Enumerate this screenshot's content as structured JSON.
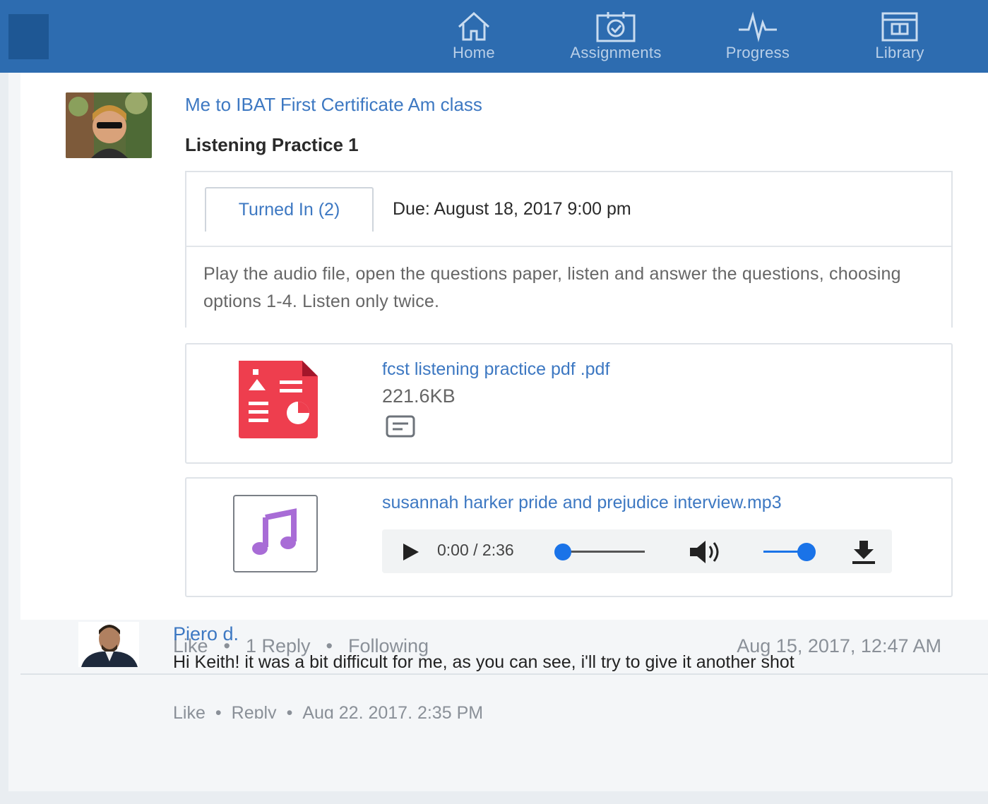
{
  "nav": {
    "items": [
      {
        "label": "Home",
        "icon": "home-icon"
      },
      {
        "label": "Assignments",
        "icon": "assignments-icon"
      },
      {
        "label": "Progress",
        "icon": "progress-icon"
      },
      {
        "label": "Library",
        "icon": "library-icon"
      }
    ]
  },
  "post": {
    "from": "Me to IBAT First Certificate Am class",
    "title": "Listening Practice 1",
    "turned_in_label": "Turned In (2)",
    "due": "Due: August 18, 2017 9:00 pm",
    "instructions": "Play the audio file, open the questions paper, listen and answer the questions, choosing options 1-4. Listen only twice.",
    "attachments": {
      "pdf": {
        "name": "fcst listening practice pdf .pdf",
        "size": "221.6KB",
        "icon": "pdf-file-icon"
      },
      "mp3": {
        "name": "susannah harker pride and prejudice interview.mp3",
        "icon": "music-icon"
      }
    },
    "player": {
      "time": "0:00 / 2:36",
      "volume": 1.0,
      "progress": 0.0
    },
    "actions": {
      "like": "Like",
      "reply": "1 Reply",
      "follow": "Following",
      "separator": "•"
    },
    "timestamp": "Aug 15, 2017, 12:47 AM"
  },
  "reply": {
    "author": "Piero d.",
    "body": "Hi Keith! it was a bit difficult for me, as you can see, i'll try to give it another shot",
    "like": "Like",
    "reply": "Reply",
    "separator": "•",
    "timestamp": "Aug 22, 2017, 2:35 PM"
  },
  "colors": {
    "header": "#2d6cb0",
    "link": "#3d78c2",
    "pdf": "#ee3e4e",
    "music": "#a86cd6",
    "player_accent": "#1a73e8"
  }
}
